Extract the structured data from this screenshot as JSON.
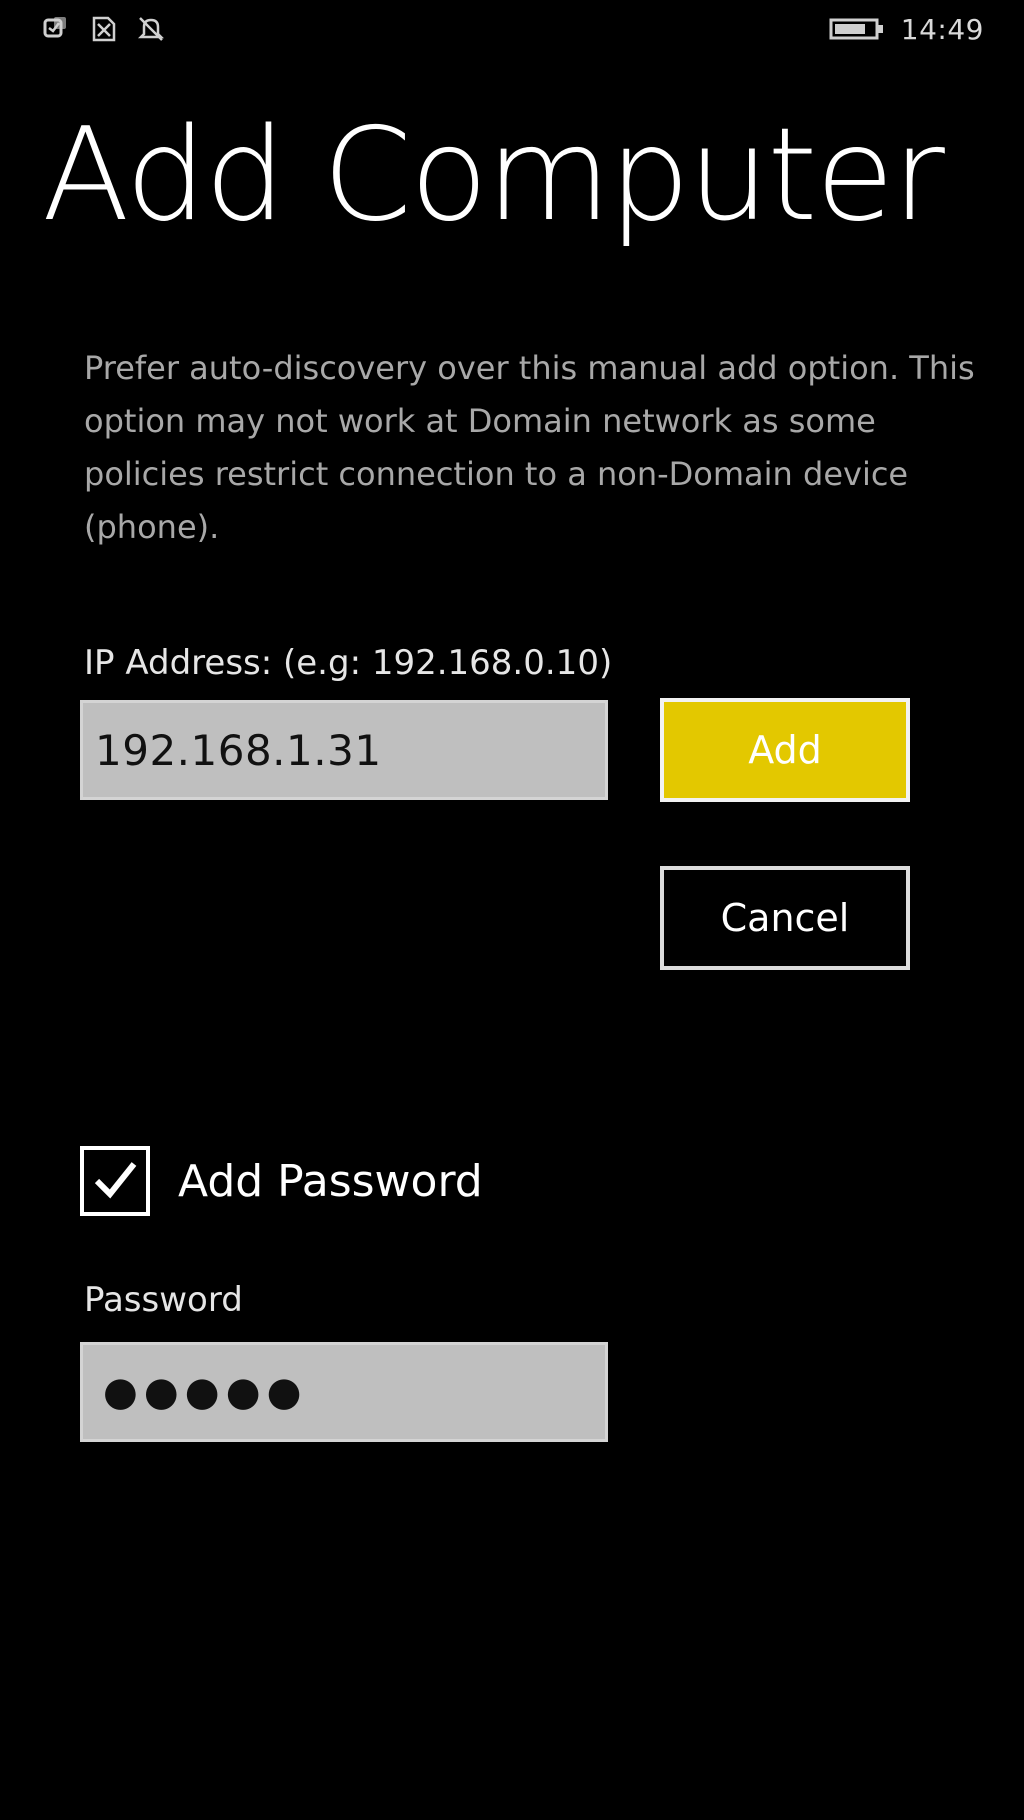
{
  "status_bar": {
    "icons": [
      "notification-icon",
      "no-sim-icon",
      "quiet-hours-icon"
    ],
    "battery_icon": "battery-icon",
    "time": "14:49"
  },
  "page": {
    "title": "Add Computer",
    "description": "Prefer auto-discovery over this manual add option. This option may not work at Domain network as some policies restrict connection to a non-Domain device (phone)."
  },
  "ip_field": {
    "label": "IP Address: (e.g: 192.168.0.10)",
    "value": "192.168.1.31"
  },
  "buttons": {
    "add_label": "Add",
    "cancel_label": "Cancel"
  },
  "password_toggle": {
    "label": "Add Password",
    "checked": true,
    "icon": "checkmark-icon"
  },
  "password_field": {
    "label": "Password",
    "masked_value": "●●●●●"
  },
  "colors": {
    "background": "#000000",
    "accent": "#e3c800",
    "field_fill": "#bfbfbf",
    "description_text": "#a8a8a8"
  }
}
